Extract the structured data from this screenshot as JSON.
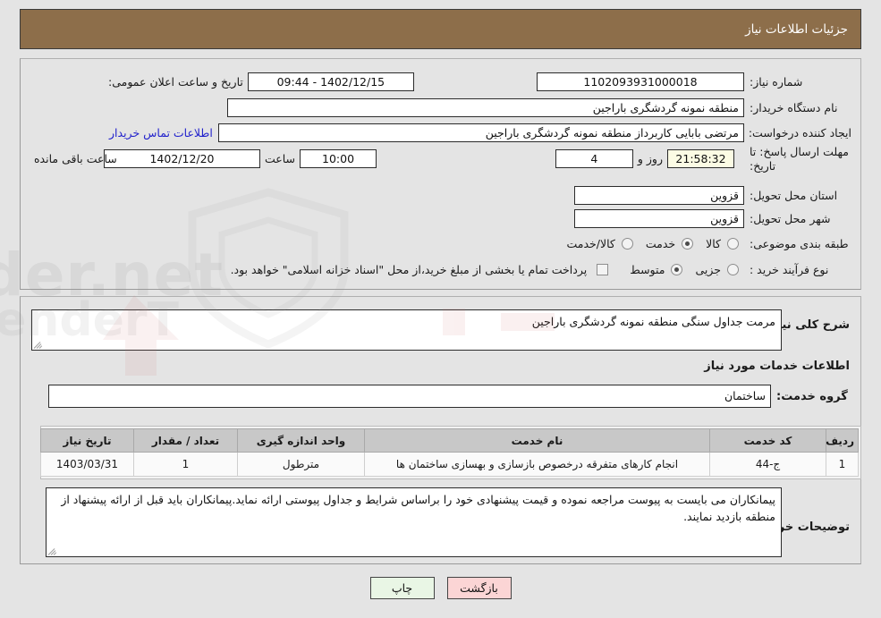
{
  "header": {
    "title": "جزئیات اطلاعات نیاز"
  },
  "request": {
    "need_number_label": "شماره نیاز:",
    "need_number_value": "1102093931000018",
    "announce_label": "تاریخ و ساعت اعلان عمومی:",
    "announce_value": "1402/12/15 - 09:44",
    "buyer_org_label": "نام دستگاه خریدار:",
    "buyer_org_value": "منطقه نمونه گردشگری باراجین",
    "creator_label": "ایجاد کننده درخواست:",
    "creator_value": "مرتضی بابایی کاربرداز منطقه نمونه گردشگری باراجین",
    "contact_link": "اطلاعات تماس خریدار",
    "deadline_label": "مهلت ارسال پاسخ: تا تاریخ:",
    "deadline_date": "1402/12/20",
    "deadline_hour_label": "ساعت",
    "deadline_time": "10:00",
    "remaining_days": "4",
    "days_and_label": "روز و",
    "remaining_clock": "21:58:32",
    "remaining_suffix": "ساعت باقی مانده",
    "province_label": "استان محل تحویل:",
    "province_value": "قزوین",
    "city_label": "شهر محل تحویل:",
    "city_value": "قزوین",
    "category_label": "طبقه بندی موضوعی:",
    "category_options": [
      {
        "label": "کالا",
        "selected": false
      },
      {
        "label": "خدمت",
        "selected": true
      },
      {
        "label": "کالا/خدمت",
        "selected": false
      }
    ],
    "process_label": "نوع فرآیند خرید :",
    "process_options": [
      {
        "label": "جزیی",
        "selected": false
      },
      {
        "label": "متوسط",
        "selected": true
      }
    ],
    "treasury_checkbox_label": "پرداخت تمام یا بخشی از مبلغ خرید،از محل \"اسناد خزانه اسلامی\" خواهد بود.",
    "treasury_checked": false
  },
  "summary": {
    "label": "شرح کلی نیاز:",
    "value": "مرمت جداول سنگی منطقه نمونه گردشگری باراجین"
  },
  "service_info": {
    "section_title": "اطلاعات خدمات مورد نیاز",
    "group_label": "گروه خدمت:",
    "group_value": "ساختمان"
  },
  "table": {
    "columns": [
      "ردیف",
      "کد خدمت",
      "نام خدمت",
      "واحد اندازه گیری",
      "تعداد / مقدار",
      "تاریخ نیاز"
    ],
    "rows": [
      {
        "row_no": "1",
        "service_code": "ج-44",
        "service_name": "انجام کارهای متفرقه درخصوص بازسازی و بهسازی ساختمان ها",
        "unit": "مترطول",
        "quantity": "1",
        "need_date": "1403/03/31"
      }
    ]
  },
  "buyer_notes": {
    "label": "توضیحات خریدار:",
    "value": "پیمانکاران می بایست به پیوست مراجعه نموده و قیمت پیشنهادی خود را براساس شرایط و جداول پیوستی ارائه نماید.پیمانکاران باید قبل از ارائه پیشنهاد از منطقه بازدید نمایند."
  },
  "footer": {
    "print_label": "چاپ",
    "back_label": "بازگشت"
  },
  "colors": {
    "header_bg": "#8d6e4a",
    "page_bg": "#e4e4e4",
    "link": "#2222cc",
    "print_btn_bg": "#e9f6e5",
    "back_btn_bg": "#fbd5d5",
    "highlight_bg": "#fbfbe4"
  }
}
